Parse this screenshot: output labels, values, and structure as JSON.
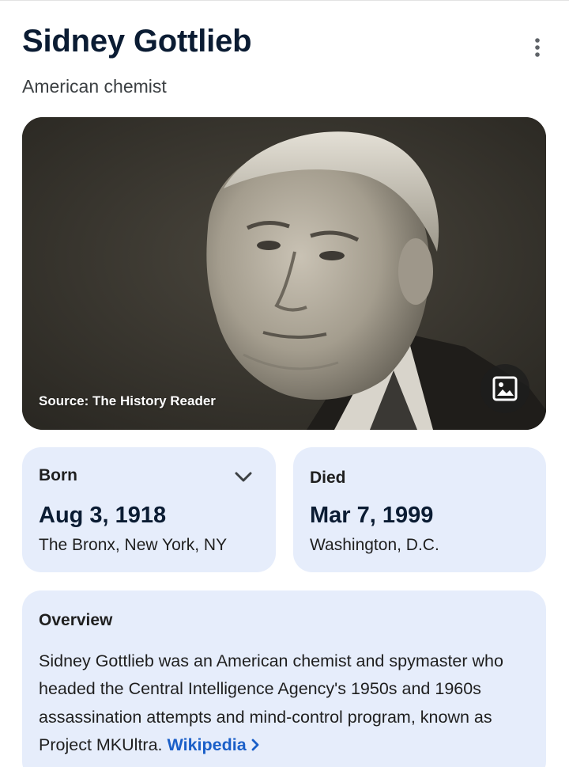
{
  "entity": {
    "name": "Sidney Gottlieb",
    "description": "American chemist"
  },
  "menu": {
    "icon": "more-vert-icon"
  },
  "photo": {
    "source_text": "Source: The History Reader",
    "image_button_icon": "image-icon"
  },
  "born": {
    "label": "Born",
    "date": "Aug 3, 1918",
    "place": "The Bronx, New York, NY",
    "expand_icon": "chevron-down-icon"
  },
  "died": {
    "label": "Died",
    "date": "Mar 7, 1999",
    "place": "Washington, D.C."
  },
  "overview": {
    "title": "Overview",
    "text": "Sidney Gottlieb was an American chemist and spymaster who headed the Central Intelligence Agency's 1950s and 1960s assassination attempts and mind-control program, known as Project MKUltra.",
    "link_label": "Wikipedia",
    "link_icon": "chevron-right-icon"
  },
  "colors": {
    "card_background": "#e6edfb",
    "title_text": "#0b1c33",
    "link": "#1a5fc8"
  }
}
